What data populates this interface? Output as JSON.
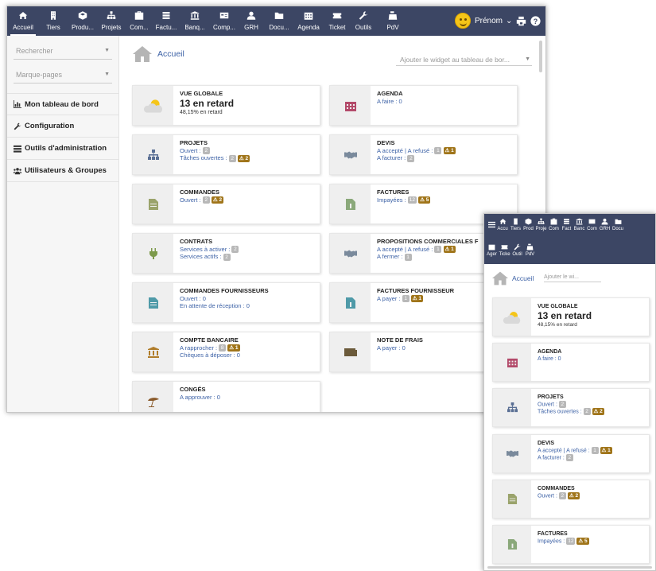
{
  "colors": {
    "topbar": "#3c4664",
    "link": "#3d62a6",
    "warning": "#a0751a",
    "badge": "#b8b8b8",
    "icon_bg": "#efefef"
  },
  "menu": [
    {
      "label": "Accueil",
      "icon": "home-icon"
    },
    {
      "label": "Tiers",
      "icon": "building-icon"
    },
    {
      "label": "Produ...",
      "icon": "cube-icon"
    },
    {
      "label": "Projets",
      "icon": "sitemap-icon"
    },
    {
      "label": "Com...",
      "icon": "suitcase-icon"
    },
    {
      "label": "Factu...",
      "icon": "money-icon"
    },
    {
      "label": "Banq...",
      "icon": "bank-icon"
    },
    {
      "label": "Comp...",
      "icon": "card-icon"
    },
    {
      "label": "GRH",
      "icon": "user-tie-icon"
    },
    {
      "label": "Docu...",
      "icon": "folder-icon"
    },
    {
      "label": "Agenda",
      "icon": "calendar-icon"
    },
    {
      "label": "Ticket",
      "icon": "ticket-icon"
    },
    {
      "label": "Outils",
      "icon": "wrench-icon"
    },
    {
      "label": "PdV",
      "icon": "cash-register-icon"
    }
  ],
  "user": {
    "name": "Prénom",
    "caret": "⌄"
  },
  "sidebar": {
    "search_label": "Rechercher",
    "bookmarks_label": "Marque-pages",
    "links": [
      {
        "label": "Mon tableau de bord",
        "icon": "chart-icon"
      },
      {
        "label": "Configuration",
        "icon": "wrench-icon"
      },
      {
        "label": "Outils d'administration",
        "icon": "server-icon"
      },
      {
        "label": "Utilisateurs & Groupes",
        "icon": "users-icon"
      }
    ]
  },
  "main": {
    "title": "Accueil",
    "widget_select": "Ajouter le widget au tableau de bor...",
    "boxes": {
      "vue_globale": {
        "title": "VUE GLOBALE",
        "value": "13 en retard",
        "sub": "48,15% en retard"
      },
      "agenda": {
        "title": "AGENDA",
        "line1": "A faire : 0"
      },
      "projets": {
        "title": "PROJETS",
        "line1": "Ouvert :",
        "b1": "2",
        "line2": "Tâches ouvertes :",
        "b2": "2",
        "w2": "⚠ 2"
      },
      "devis": {
        "title": "DEVIS",
        "line1": "A accepté | A refusé :",
        "b1": "1",
        "w1": "⚠ 1",
        "line2": "A facturer :",
        "b2": "2"
      },
      "commandes": {
        "title": "COMMANDES",
        "line1": "Ouvert :",
        "b1": "2",
        "w1": "⚠ 2"
      },
      "factures": {
        "title": "FACTURES",
        "line1": "Impayées :",
        "b1": "12",
        "w1": "⚠ 5"
      },
      "contrats": {
        "title": "CONTRATS",
        "line1": "Services à activer :",
        "b1": "2",
        "line2": "Services actifs :",
        "b2": "2"
      },
      "propositions": {
        "title": "PROPOSITIONS COMMERCIALES F",
        "line1": "A accepté | A refusé :",
        "b1": "1",
        "w1": "⚠ 1",
        "line2": "A fermer :",
        "b2": "1"
      },
      "cmd_fourn": {
        "title": "COMMANDES FOURNISSEURS",
        "line1": "Ouvert : 0",
        "line2": "En attente de réception : 0"
      },
      "fact_fourn": {
        "title": "FACTURES FOURNISSEUR",
        "line1": "A payer :",
        "b1": "1",
        "w1": "⚠ 1"
      },
      "compte": {
        "title": "COMPTE BANCAIRE",
        "line1": "A rapprocher :",
        "b1": "8",
        "w1": "⚠ 1",
        "line2": "Chèques à déposer : 0"
      },
      "frais": {
        "title": "NOTE DE FRAIS",
        "line1": "A payer : 0"
      },
      "conges": {
        "title": "CONGÉS",
        "line1": "A approuver : 0"
      }
    }
  },
  "mobile": {
    "menu": [
      "Accu",
      "Tiers",
      "Prod",
      "Proje",
      "Com",
      "Fact",
      "Banc",
      "Com",
      "GRH",
      "Docu",
      "Ager",
      "Ticke",
      "Outil",
      "PdV"
    ],
    "title": "Accueil",
    "widget_select": "Ajouter le wi...",
    "boxes": {
      "vue_globale": {
        "title": "VUE GLOBALE",
        "value": "13 en retard",
        "sub": "48,15% en retard"
      },
      "agenda": {
        "title": "AGENDA",
        "line1": "A faire : 0"
      },
      "projets": {
        "title": "PROJETS",
        "line1": "Ouvert :",
        "b1": "2",
        "line2": "Tâches ouvertes :",
        "b2": "2",
        "w2": "⚠ 2"
      },
      "devis": {
        "title": "DEVIS",
        "line1": "A accepté | A refusé :",
        "b1": "1",
        "w1": "⚠ 1",
        "line2": "A facturer :",
        "b2": "2"
      },
      "commandes": {
        "title": "COMMANDES",
        "line1": "Ouvert :",
        "b1": "2",
        "w1": "⚠ 2"
      },
      "factures": {
        "title": "FACTURES",
        "line1": "Impayées :",
        "b1": "12",
        "w1": "⚠ 5"
      }
    }
  }
}
